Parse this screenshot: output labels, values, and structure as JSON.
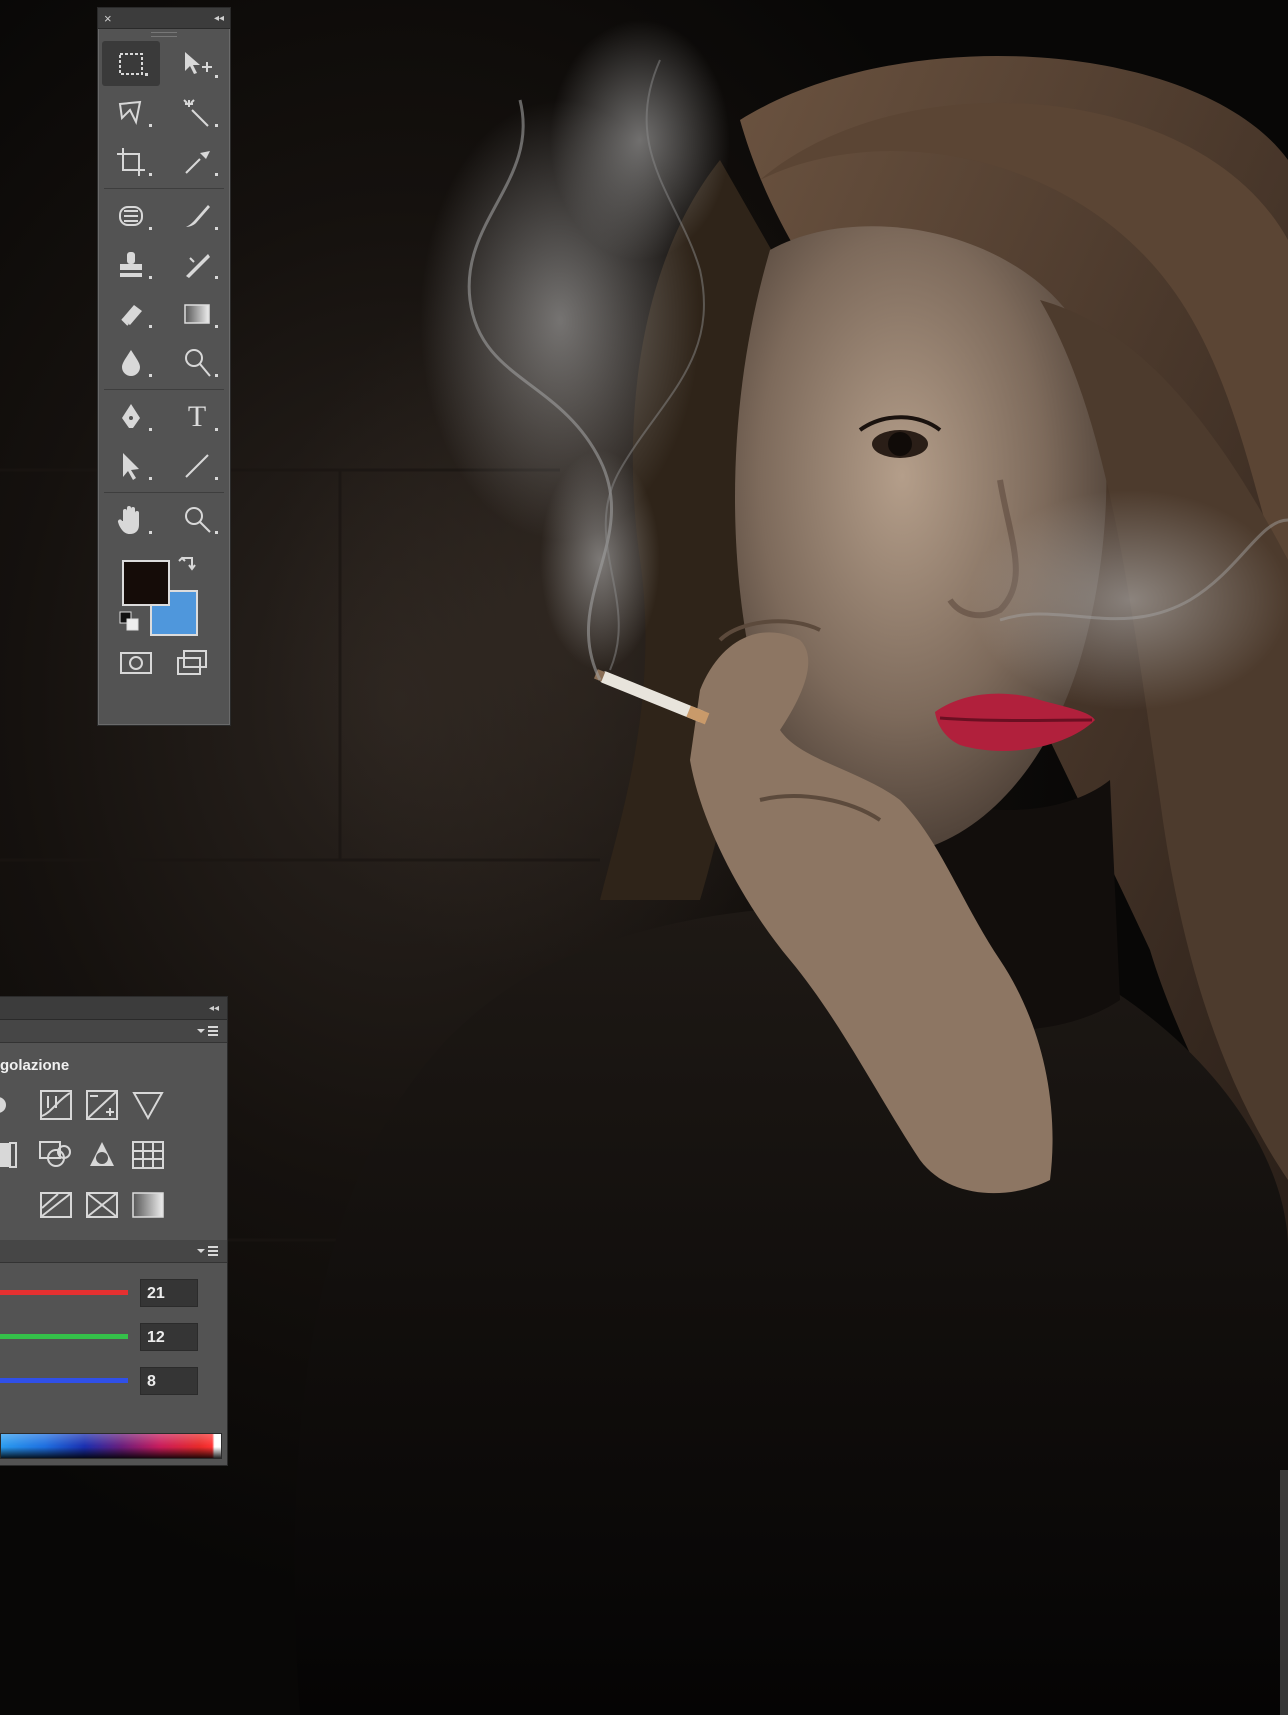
{
  "window": {
    "close_glyph": "×",
    "collapse_glyph": "◂◂"
  },
  "tools": [
    {
      "name": "rectangular-marquee-tool",
      "icon": "marquee-icon",
      "selected": true
    },
    {
      "name": "move-tool",
      "icon": "move-icon"
    },
    {
      "name": "lasso-tool",
      "icon": "lasso-icon"
    },
    {
      "name": "magic-wand-tool",
      "icon": "magic-wand-icon"
    },
    {
      "name": "crop-tool",
      "icon": "crop-icon"
    },
    {
      "name": "eyedropper-tool",
      "icon": "eyedropper-icon"
    },
    {
      "name": "spot-healing-tool",
      "icon": "healing-icon"
    },
    {
      "name": "brush-tool",
      "icon": "brush-icon"
    },
    {
      "name": "clone-stamp-tool",
      "icon": "stamp-icon"
    },
    {
      "name": "history-brush-tool",
      "icon": "history-brush-icon"
    },
    {
      "name": "eraser-tool",
      "icon": "eraser-icon"
    },
    {
      "name": "gradient-tool",
      "icon": "gradient-icon"
    },
    {
      "name": "blur-tool",
      "icon": "blur-drop-icon"
    },
    {
      "name": "dodge-tool",
      "icon": "dodge-icon"
    },
    {
      "name": "pen-tool",
      "icon": "pen-icon"
    },
    {
      "name": "type-tool",
      "icon": "type-icon"
    },
    {
      "name": "path-selection-tool",
      "icon": "arrow-icon"
    },
    {
      "name": "line-tool",
      "icon": "line-icon"
    },
    {
      "name": "hand-tool",
      "icon": "hand-icon"
    },
    {
      "name": "zoom-tool",
      "icon": "zoom-icon"
    }
  ],
  "type_tool_glyph": "T",
  "colors": {
    "foreground": "#150c08",
    "background": "#4f97dc"
  },
  "adjustments": {
    "title": "golazione",
    "icon_rows": [
      [
        "brightness-icon",
        "curves-icon",
        "exposure-icon",
        "triangle-icon"
      ],
      [
        "vibrance-icon",
        "hue-saturation-icon",
        "color-balance-icon",
        "black-white-icon",
        "channel-mixer-icon"
      ],
      [
        "invert-icon",
        "posterize-icon",
        "threshold-icon",
        "gradient-map-icon"
      ]
    ]
  },
  "color_panel": {
    "r": {
      "value": "21",
      "color": "#e53030"
    },
    "g": {
      "value": "12",
      "color": "#35c04a"
    },
    "b": {
      "value": "8",
      "color": "#3050e8"
    }
  },
  "panel_menu_glyph": "▾≡"
}
